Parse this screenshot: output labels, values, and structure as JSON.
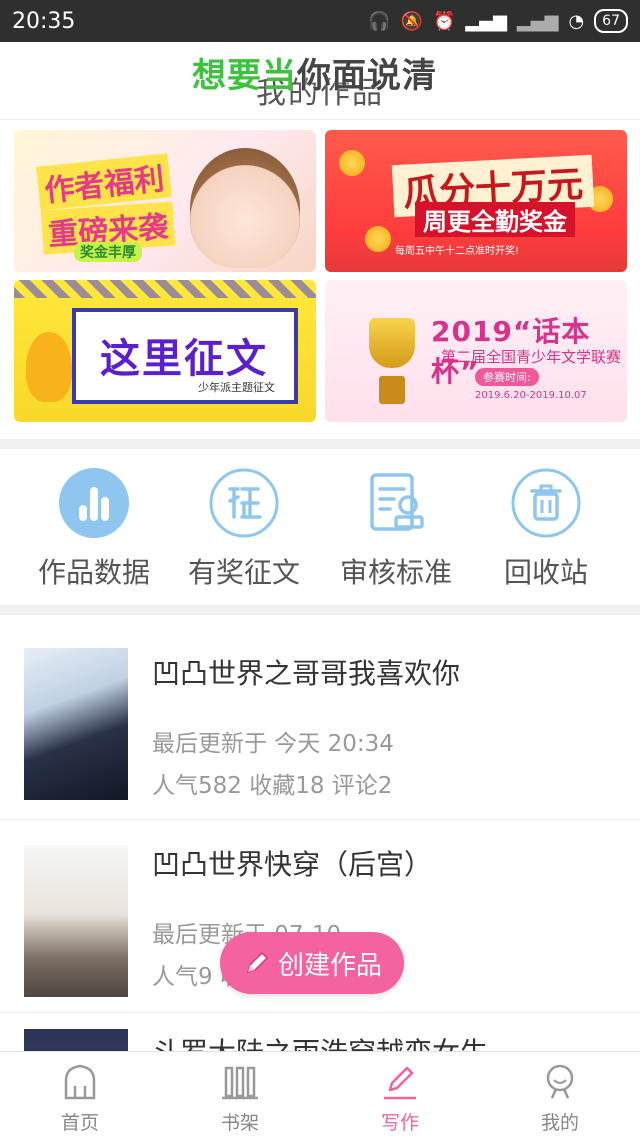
{
  "status_bar": {
    "time": "20:35",
    "battery": "67"
  },
  "header": {
    "title": "我的作品",
    "overlay_green": "想要当",
    "overlay_dark": "你面说清"
  },
  "banners": [
    {
      "line1": "作者福利",
      "line2": "重磅来袭",
      "badge": "奖金丰厚"
    },
    {
      "line1": "瓜分十万元",
      "line2": "周更全勤奖金",
      "note": "每周五中午十二点准时开奖!"
    },
    {
      "line1": "这里征文",
      "tag": "少年派主题征文"
    },
    {
      "line1": "2019“话本杯”",
      "line2": "第二届全国青少年文学联赛",
      "button": "参赛时间:",
      "dates": "2019.6.20-2019.10.07"
    }
  ],
  "quick_entries": [
    {
      "label": "作品数据",
      "icon": "bar-chart-icon"
    },
    {
      "label": "有奖征文",
      "icon": "zheng-badge-icon"
    },
    {
      "label": "审核标准",
      "icon": "document-review-icon"
    },
    {
      "label": "回收站",
      "icon": "trash-icon"
    }
  ],
  "works": [
    {
      "title": "凹凸世界之哥哥我喜欢你",
      "updated": "最后更新于 今天 20:34",
      "stats": "人气582 收藏18 评论2"
    },
    {
      "title": "凹凸世界快穿（后宫）",
      "updated": "最后更新于 07-10",
      "stats": "人气9 收藏 评论3"
    },
    {
      "title": "斗罗大陆之雨浩穿越变女生"
    }
  ],
  "fab": {
    "label": "创建作品"
  },
  "tabs": [
    {
      "label": "首页",
      "icon": "home-icon"
    },
    {
      "label": "书架",
      "icon": "bookshelf-icon"
    },
    {
      "label": "写作",
      "icon": "pen-icon"
    },
    {
      "label": "我的",
      "icon": "profile-icon"
    }
  ],
  "colors": {
    "accent_pink": "#f462a0",
    "icon_blue": "#8fc6f0",
    "overlay_green": "#3cc23c"
  }
}
